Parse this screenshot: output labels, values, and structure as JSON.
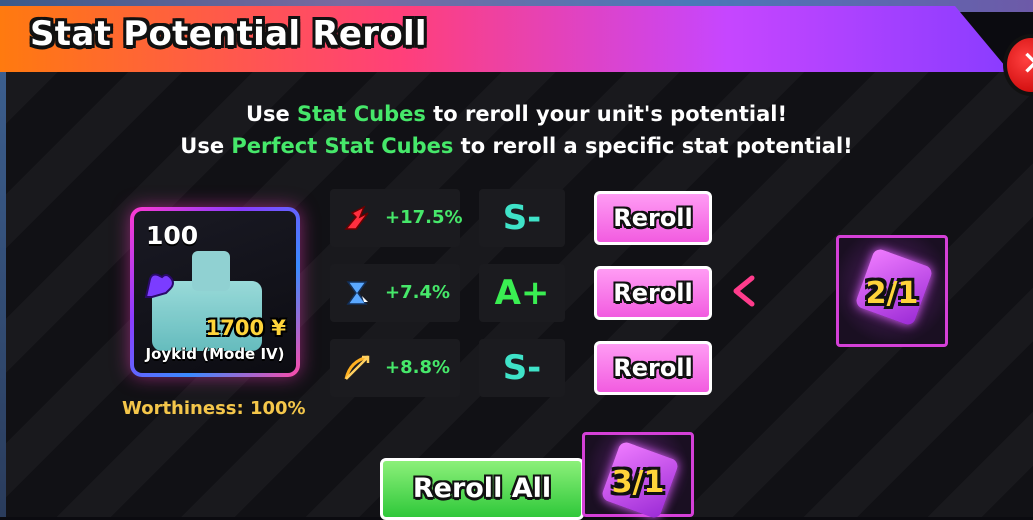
{
  "header": {
    "title": "Stat Potential Reroll",
    "close_icon": "close-icon"
  },
  "intro": {
    "line1_prefix": "Use ",
    "line1_highlight": "Stat Cubes",
    "line1_suffix": " to reroll your unit's potential!",
    "line2_prefix": "Use ",
    "line2_highlight": "Perfect Stat Cubes",
    "line2_suffix": " to reroll a specific stat potential!"
  },
  "unit": {
    "level": "100",
    "cost": "1700 ¥",
    "name": "Joykid (Mode IV)",
    "worthiness": "Worthiness: 100%",
    "icon": "muscle-icon"
  },
  "stats": [
    {
      "icon": "damage-icon",
      "value": "+17.5%",
      "grade": "S-",
      "button": "Reroll"
    },
    {
      "icon": "cooldown-icon",
      "value": "+7.4%",
      "grade": "A+",
      "button": "Reroll"
    },
    {
      "icon": "range-icon",
      "value": "+8.8%",
      "grade": "S-",
      "button": "Reroll"
    }
  ],
  "perfect_cube": {
    "count": "2/1",
    "icon": "perfect-stat-cube-icon"
  },
  "stat_cube": {
    "count": "3/1",
    "icon": "stat-cube-icon"
  },
  "reroll_all": {
    "label": "Reroll All"
  },
  "colors": {
    "accent_green": "#46e86a",
    "grade_s": "#3fe3c8",
    "grade_a": "#3aee52",
    "button_pink": "#f25ce0",
    "gold": "#ffd43a"
  }
}
